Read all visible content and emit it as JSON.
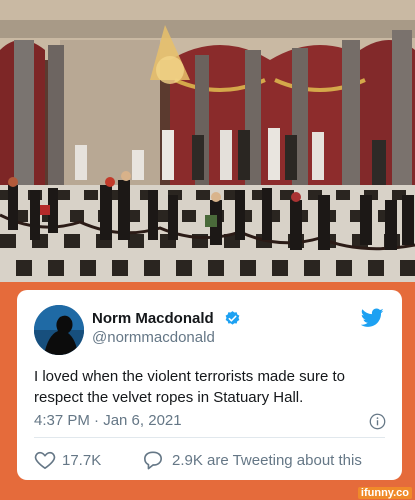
{
  "tweet": {
    "name": "Norm Macdonald",
    "handle": "@normmacdonald",
    "text": "I loved when the violent terrorists made sure to respect the velvet ropes in Statuary Hall.",
    "timestamp": "4:37 PM · Jan 6, 2021",
    "likes": "17.7K",
    "replies": "2.9K are Tweeting about this"
  },
  "watermark": "ifunny.co",
  "colors": {
    "frame": "#e56b3b",
    "twitter_blue": "#1da1f2",
    "text": "#14171a",
    "muted": "#657786"
  },
  "icons": [
    "verified-badge-icon",
    "twitter-bird-icon",
    "info-icon",
    "heart-icon",
    "reply-bubble-icon"
  ]
}
